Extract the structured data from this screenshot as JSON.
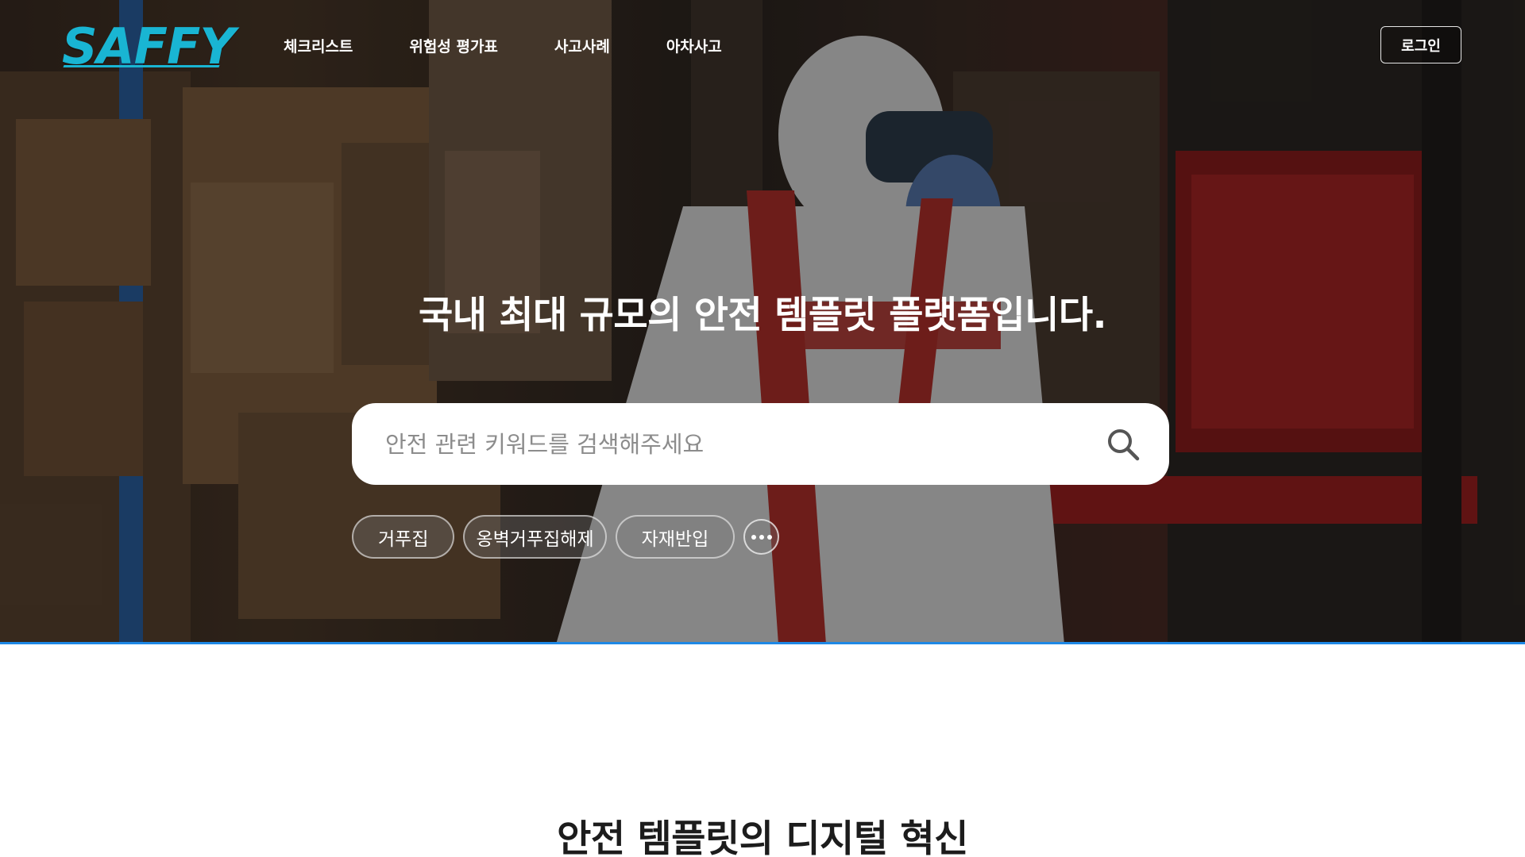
{
  "header": {
    "logo_text": "SAFFY",
    "nav": [
      {
        "label": "체크리스트"
      },
      {
        "label": "위험성 평가표"
      },
      {
        "label": "사고사례"
      },
      {
        "label": "아차사고"
      }
    ],
    "login_label": "로그인"
  },
  "hero": {
    "headline": "국내 최대 규모의 안전 템플릿 플랫폼입니다.",
    "search": {
      "placeholder": "안전 관련 키워드를 검색해주세요",
      "value": ""
    },
    "tags": [
      {
        "label": "거푸집"
      },
      {
        "label": "옹벽거푸집해제"
      },
      {
        "label": "자재반입"
      }
    ],
    "more_icon": "ellipsis-icon"
  },
  "section": {
    "title": "안전 템플릿의 디지털 혁신"
  },
  "colors": {
    "brand": "#19b5d3",
    "hero_border": "#1e88e5",
    "text_dark": "#1c1c1c",
    "placeholder": "#8c8c8c"
  },
  "icons": {
    "search": "search-icon",
    "more": "ellipsis-icon"
  }
}
